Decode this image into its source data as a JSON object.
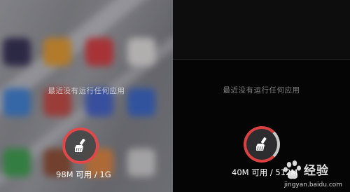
{
  "left_screen": {
    "empty_message": "最近没有运行任何应用",
    "memory": "98M 可用 / 1G",
    "accent_color": "#e0484a"
  },
  "right_screen": {
    "empty_message": "最近没有运行任何应用",
    "memory": "40M 可用 / 512M",
    "accent_color": "#d9403f"
  },
  "watermark": {
    "name": "经验",
    "url": "jingyan.baidu.com"
  },
  "icons": {
    "clean_button": "broom-icon",
    "watermark_logo": "baidu-paw-icon"
  }
}
